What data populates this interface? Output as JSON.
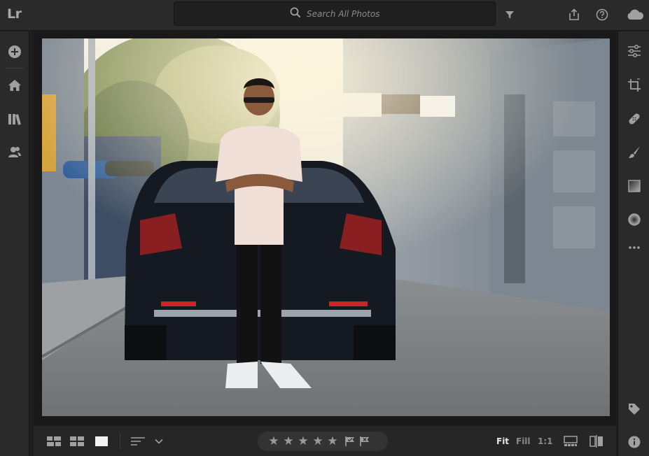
{
  "app": {
    "logo": "Lr"
  },
  "search": {
    "placeholder": "Search All Photos"
  },
  "top_icons": [
    "filter-icon",
    "share-icon",
    "help-icon",
    "cloud-icon"
  ],
  "left_sidebar": {
    "items": [
      "add-photos-icon",
      "home-icon",
      "library-icon",
      "people-icon"
    ]
  },
  "right_sidebar": {
    "items": [
      "edit-sliders-icon",
      "crop-icon",
      "healing-icon",
      "brush-icon",
      "linear-gradient-icon",
      "radial-gradient-icon",
      "more-icon",
      "keyword-tag-icon",
      "info-icon"
    ]
  },
  "bottom": {
    "views": [
      "square-grid-icon",
      "photo-grid-icon",
      "detail-view-icon"
    ],
    "sort_icon": "sort-icon",
    "rating": {
      "stars": [
        "★",
        "★",
        "★",
        "★",
        "★"
      ],
      "value": 0,
      "max": 5
    },
    "flags": [
      "pick-flag-icon",
      "reject-flag-icon"
    ],
    "zoom": {
      "fit": "Fit",
      "fill": "Fill",
      "one_to_one": "1:1",
      "selected": "Fit"
    },
    "compare_icon": "before-after-icon",
    "filmstrip_icon": "filmstrip-icon"
  },
  "colors": {
    "accent": "#e6e6e6",
    "panel": "#2a2a2a",
    "background": "#1d1d1d"
  }
}
